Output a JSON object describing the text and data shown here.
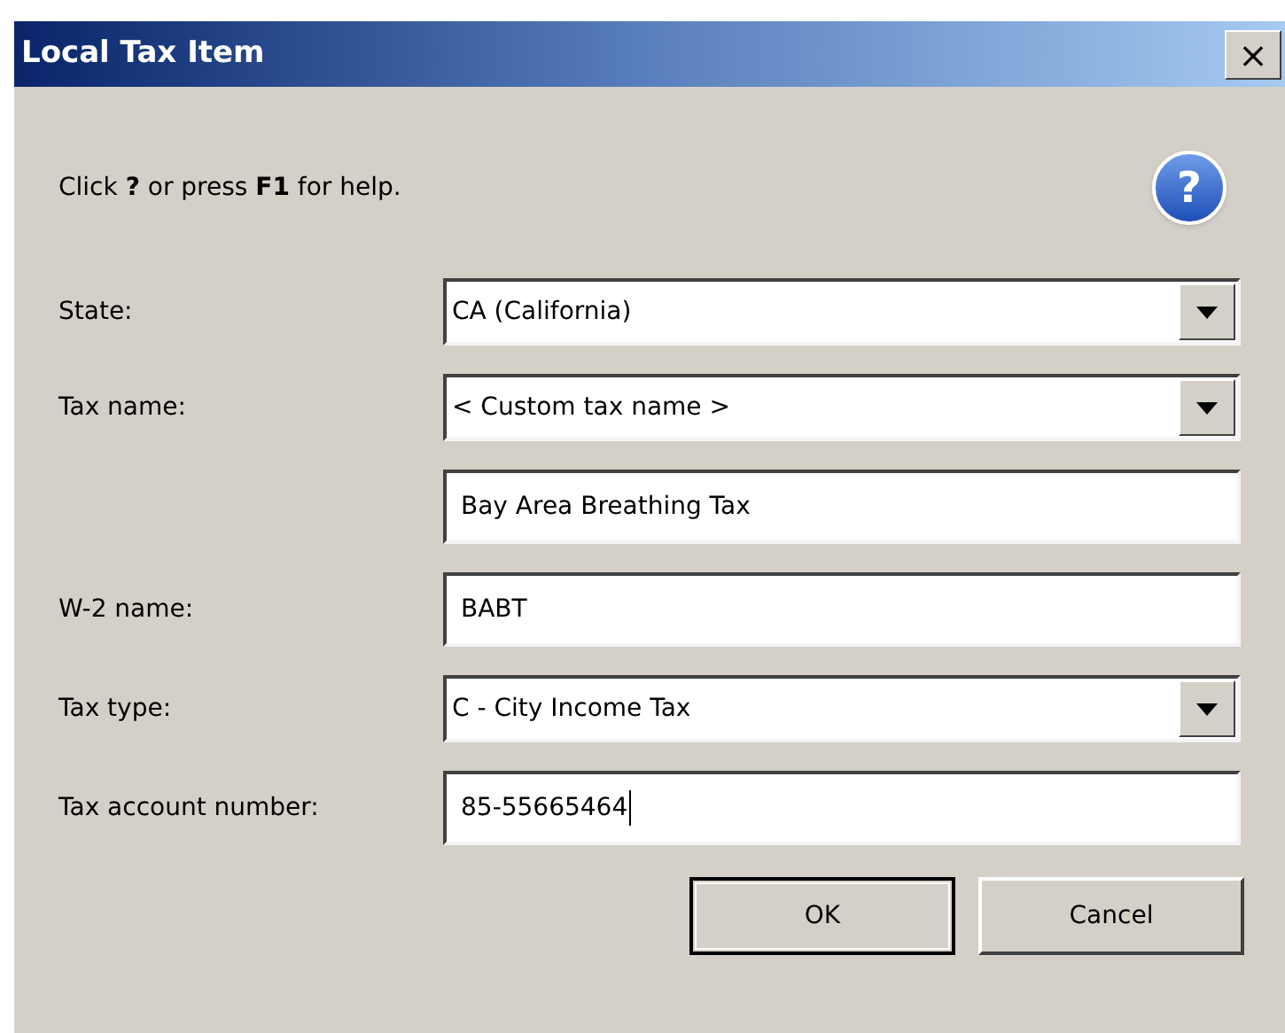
{
  "window": {
    "title": "Local Tax Item",
    "close_symbol": "×"
  },
  "help_text": "Click **?** or press **F1** for help.",
  "help_icon_symbol": "?",
  "fields": [
    {
      "label": "State:",
      "kind": "combo",
      "value": "CA (California)",
      "focused": false
    },
    {
      "label": "Tax name:",
      "kind": "combo",
      "value": "< Custom tax name >",
      "focused": false
    },
    {
      "kind": "text",
      "value": "Bay Area Breathing Tax",
      "focused": false
    },
    {
      "label": "W-2 name:",
      "kind": "text",
      "value": "BABT",
      "focused": false
    },
    {
      "label": "Tax type:",
      "kind": "combo",
      "value": "C - City Income Tax",
      "focused": false
    },
    {
      "label": "Tax account number:",
      "kind": "text",
      "value": "85-55665464",
      "focused": true
    }
  ],
  "buttons": [
    {
      "label": "OK",
      "default": true
    },
    {
      "label": "Cancel",
      "default": false
    }
  ]
}
